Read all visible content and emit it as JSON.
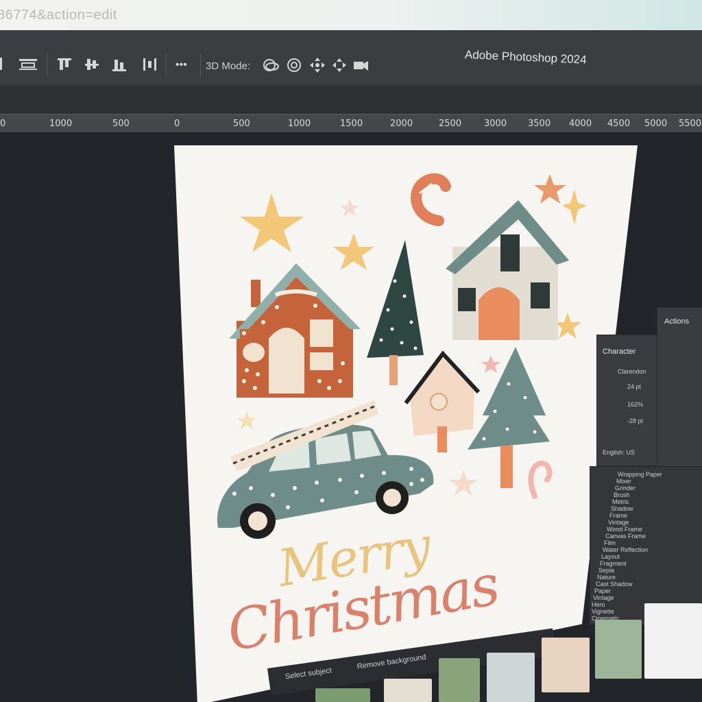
{
  "browser": {
    "url_fragment": "86774&action=edit"
  },
  "app": {
    "title": "Adobe Photoshop 2024"
  },
  "options_bar": {
    "mode_label": "3D Mode:",
    "more_label": "•••"
  },
  "ruler": {
    "labels": [
      "0",
      "1000",
      "500",
      "0",
      "500",
      "1000",
      "1500",
      "2000",
      "2500",
      "3000",
      "3500",
      "4000",
      "4500",
      "5000",
      "5500"
    ]
  },
  "artwork": {
    "line1": "Merry",
    "line2": "Christmas"
  },
  "panels": {
    "character_tab": "Character",
    "layers_tab": "Actions",
    "char_font": "Clarendon",
    "char_size": "24 pt",
    "char_leading": "162%",
    "char_tracking": "-28 pt",
    "char_language": "English: US",
    "layer_names": [
      "Wrapping Paper",
      "Mixer",
      "Grinder",
      "Brush",
      "Metric",
      "Shadow",
      "Frame",
      "Vintage",
      "Wood Frame",
      "Canvas Frame",
      "Film",
      "Water Reflection",
      "Layout",
      "Fragment",
      "Sepia",
      "Nature",
      "Cast Shadow",
      "Paper",
      "Vintage",
      "Hero",
      "Vignette",
      "Cinematic"
    ]
  },
  "bottom_bar": {
    "select_subject": "Select subject",
    "remove_background": "Remove background"
  },
  "colors": {
    "canvas_bg": "#f6f5f1",
    "star": "#f2c878",
    "teal": "#6f8d88",
    "rust": "#c5643a",
    "cream": "#f1e3d0",
    "merry": "#e9c47c",
    "christmas": "#d9816a"
  }
}
